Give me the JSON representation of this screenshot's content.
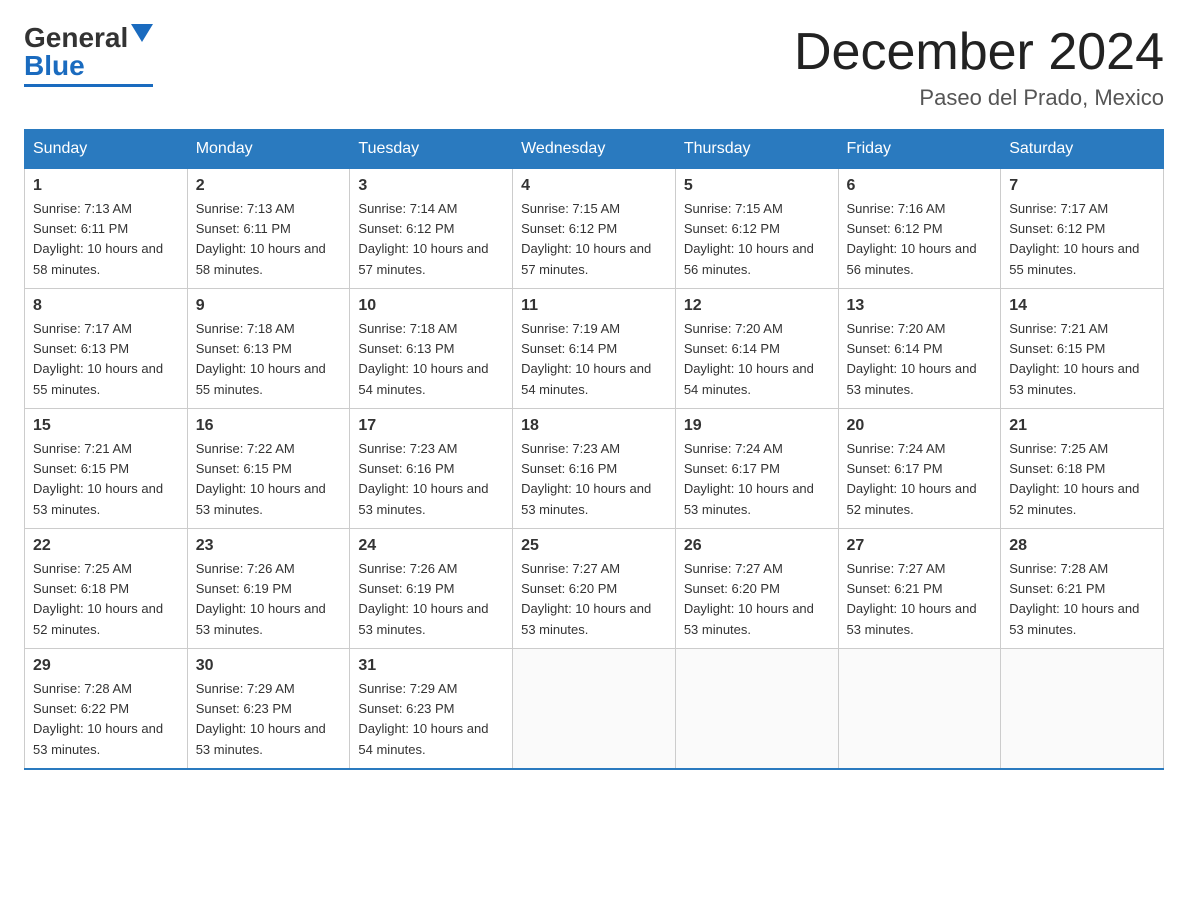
{
  "header": {
    "logo_general": "General",
    "logo_blue": "Blue",
    "month": "December 2024",
    "location": "Paseo del Prado, Mexico"
  },
  "days_of_week": [
    "Sunday",
    "Monday",
    "Tuesday",
    "Wednesday",
    "Thursday",
    "Friday",
    "Saturday"
  ],
  "weeks": [
    [
      {
        "day": "1",
        "sunrise": "7:13 AM",
        "sunset": "6:11 PM",
        "daylight": "10 hours and 58 minutes."
      },
      {
        "day": "2",
        "sunrise": "7:13 AM",
        "sunset": "6:11 PM",
        "daylight": "10 hours and 58 minutes."
      },
      {
        "day": "3",
        "sunrise": "7:14 AM",
        "sunset": "6:12 PM",
        "daylight": "10 hours and 57 minutes."
      },
      {
        "day": "4",
        "sunrise": "7:15 AM",
        "sunset": "6:12 PM",
        "daylight": "10 hours and 57 minutes."
      },
      {
        "day": "5",
        "sunrise": "7:15 AM",
        "sunset": "6:12 PM",
        "daylight": "10 hours and 56 minutes."
      },
      {
        "day": "6",
        "sunrise": "7:16 AM",
        "sunset": "6:12 PM",
        "daylight": "10 hours and 56 minutes."
      },
      {
        "day": "7",
        "sunrise": "7:17 AM",
        "sunset": "6:12 PM",
        "daylight": "10 hours and 55 minutes."
      }
    ],
    [
      {
        "day": "8",
        "sunrise": "7:17 AM",
        "sunset": "6:13 PM",
        "daylight": "10 hours and 55 minutes."
      },
      {
        "day": "9",
        "sunrise": "7:18 AM",
        "sunset": "6:13 PM",
        "daylight": "10 hours and 55 minutes."
      },
      {
        "day": "10",
        "sunrise": "7:18 AM",
        "sunset": "6:13 PM",
        "daylight": "10 hours and 54 minutes."
      },
      {
        "day": "11",
        "sunrise": "7:19 AM",
        "sunset": "6:14 PM",
        "daylight": "10 hours and 54 minutes."
      },
      {
        "day": "12",
        "sunrise": "7:20 AM",
        "sunset": "6:14 PM",
        "daylight": "10 hours and 54 minutes."
      },
      {
        "day": "13",
        "sunrise": "7:20 AM",
        "sunset": "6:14 PM",
        "daylight": "10 hours and 53 minutes."
      },
      {
        "day": "14",
        "sunrise": "7:21 AM",
        "sunset": "6:15 PM",
        "daylight": "10 hours and 53 minutes."
      }
    ],
    [
      {
        "day": "15",
        "sunrise": "7:21 AM",
        "sunset": "6:15 PM",
        "daylight": "10 hours and 53 minutes."
      },
      {
        "day": "16",
        "sunrise": "7:22 AM",
        "sunset": "6:15 PM",
        "daylight": "10 hours and 53 minutes."
      },
      {
        "day": "17",
        "sunrise": "7:23 AM",
        "sunset": "6:16 PM",
        "daylight": "10 hours and 53 minutes."
      },
      {
        "day": "18",
        "sunrise": "7:23 AM",
        "sunset": "6:16 PM",
        "daylight": "10 hours and 53 minutes."
      },
      {
        "day": "19",
        "sunrise": "7:24 AM",
        "sunset": "6:17 PM",
        "daylight": "10 hours and 53 minutes."
      },
      {
        "day": "20",
        "sunrise": "7:24 AM",
        "sunset": "6:17 PM",
        "daylight": "10 hours and 52 minutes."
      },
      {
        "day": "21",
        "sunrise": "7:25 AM",
        "sunset": "6:18 PM",
        "daylight": "10 hours and 52 minutes."
      }
    ],
    [
      {
        "day": "22",
        "sunrise": "7:25 AM",
        "sunset": "6:18 PM",
        "daylight": "10 hours and 52 minutes."
      },
      {
        "day": "23",
        "sunrise": "7:26 AM",
        "sunset": "6:19 PM",
        "daylight": "10 hours and 53 minutes."
      },
      {
        "day": "24",
        "sunrise": "7:26 AM",
        "sunset": "6:19 PM",
        "daylight": "10 hours and 53 minutes."
      },
      {
        "day": "25",
        "sunrise": "7:27 AM",
        "sunset": "6:20 PM",
        "daylight": "10 hours and 53 minutes."
      },
      {
        "day": "26",
        "sunrise": "7:27 AM",
        "sunset": "6:20 PM",
        "daylight": "10 hours and 53 minutes."
      },
      {
        "day": "27",
        "sunrise": "7:27 AM",
        "sunset": "6:21 PM",
        "daylight": "10 hours and 53 minutes."
      },
      {
        "day": "28",
        "sunrise": "7:28 AM",
        "sunset": "6:21 PM",
        "daylight": "10 hours and 53 minutes."
      }
    ],
    [
      {
        "day": "29",
        "sunrise": "7:28 AM",
        "sunset": "6:22 PM",
        "daylight": "10 hours and 53 minutes."
      },
      {
        "day": "30",
        "sunrise": "7:29 AM",
        "sunset": "6:23 PM",
        "daylight": "10 hours and 53 minutes."
      },
      {
        "day": "31",
        "sunrise": "7:29 AM",
        "sunset": "6:23 PM",
        "daylight": "10 hours and 54 minutes."
      },
      null,
      null,
      null,
      null
    ]
  ]
}
